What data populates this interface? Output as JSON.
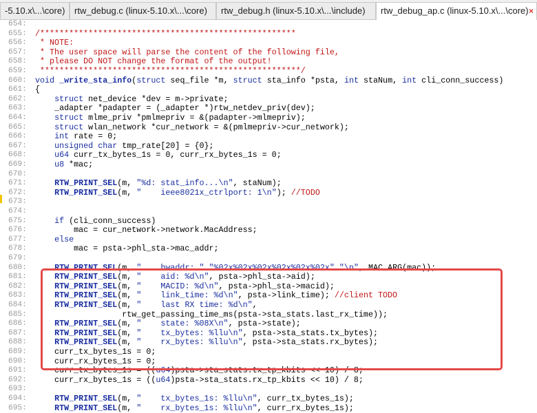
{
  "tabs": [
    {
      "label": "-5.10.x\\...\\core)",
      "active": false
    },
    {
      "label": "rtw_debug.c (linux-5.10.x\\...\\core)",
      "active": false
    },
    {
      "label": "rtw_debug.h (linux-5.10.x\\...\\include)",
      "active": false
    },
    {
      "label": "rtw_debug_ap.c (linux-5.10.x\\...\\core)",
      "active": true
    }
  ],
  "close_glyph": "×",
  "lines": [
    {
      "n": "654:",
      "t": ""
    },
    {
      "n": "655:",
      "t": "/*****************************************************"
    },
    {
      "n": "656:",
      "t": " * NOTE:"
    },
    {
      "n": "657:",
      "t": " * The user space will parse the content of the following file,"
    },
    {
      "n": "658:",
      "t": " * please DO NOT change the format of the output!"
    },
    {
      "n": "659:",
      "t": " ******************************************************/"
    },
    {
      "n": "660:",
      "t": "void _write_sta_info(struct seq_file *m, struct sta_info *psta, int staNum, int cli_conn_success)"
    },
    {
      "n": "661:",
      "t": "{"
    },
    {
      "n": "662:",
      "t": "    struct net_device *dev = m->private;"
    },
    {
      "n": "663:",
      "t": "    _adapter *padapter = (_adapter *)rtw_netdev_priv(dev);"
    },
    {
      "n": "664:",
      "t": "    struct mlme_priv *pmlmepriv = &(padapter->mlmepriv);"
    },
    {
      "n": "665:",
      "t": "    struct wlan_network *cur_network = &(pmlmepriv->cur_network);"
    },
    {
      "n": "666:",
      "t": "    int rate = 0;"
    },
    {
      "n": "667:",
      "t": "    unsigned char tmp_rate[20] = {0};"
    },
    {
      "n": "668:",
      "t": "    u64 curr_tx_bytes_1s = 0, curr_rx_bytes_1s = 0;"
    },
    {
      "n": "669:",
      "t": "    u8 *mac;"
    },
    {
      "n": "670:",
      "t": ""
    },
    {
      "n": "671:",
      "t": "    RTW_PRINT_SEL(m, \"%d: stat_info...\\n\", staNum);"
    },
    {
      "n": "672:",
      "t": "    RTW_PRINT_SEL(m, \"    ieee8021x_ctrlport: 1\\n\"); //TODO"
    },
    {
      "n": "673:",
      "t": ""
    },
    {
      "n": "674:",
      "t": ""
    },
    {
      "n": "675:",
      "t": "    if (cli_conn_success)"
    },
    {
      "n": "676:",
      "t": "        mac = cur_network->network.MacAddress;"
    },
    {
      "n": "677:",
      "t": "    else"
    },
    {
      "n": "678:",
      "t": "        mac = psta->phl_sta->mac_addr;"
    },
    {
      "n": "679:",
      "t": ""
    },
    {
      "n": "680:",
      "t": "    RTW_PRINT_SEL(m, \"    hwaddr: \" \"%02x%02x%02x%02x%02x%02x\" \"\\n\", MAC_ARG(mac));"
    },
    {
      "n": "681:",
      "t": "    RTW_PRINT_SEL(m, \"    aid: %d\\n\", psta->phl_sta->aid);"
    },
    {
      "n": "682:",
      "t": "    RTW_PRINT_SEL(m, \"    MACID: %d\\n\", psta->phl_sta->macid);"
    },
    {
      "n": "683:",
      "t": "    RTW_PRINT_SEL(m, \"    link_time: %d\\n\", psta->link_time); //client TODO"
    },
    {
      "n": "684:",
      "t": "    RTW_PRINT_SEL(m, \"    last RX time: %d\\n\","
    },
    {
      "n": "685:",
      "t": "                  rtw_get_passing_time_ms(psta->sta_stats.last_rx_time));"
    },
    {
      "n": "686:",
      "t": "    RTW_PRINT_SEL(m, \"    state: %08X\\n\", psta->state);"
    },
    {
      "n": "687:",
      "t": "    RTW_PRINT_SEL(m, \"    tx_bytes: %llu\\n\", psta->sta_stats.tx_bytes);"
    },
    {
      "n": "688:",
      "t": "    RTW_PRINT_SEL(m, \"    rx_bytes: %llu\\n\", psta->sta_stats.rx_bytes);"
    },
    {
      "n": "689:",
      "t": "    curr_tx_bytes_1s = 0;"
    },
    {
      "n": "690:",
      "t": "    curr_rx_bytes_1s = 0;"
    },
    {
      "n": "691:",
      "t": "    curr_tx_bytes_1s = ((u64)psta->sta_stats.tx_tp_kbits << 10) / 8;"
    },
    {
      "n": "692:",
      "t": "    curr_rx_bytes_1s = ((u64)psta->sta_stats.rx_tp_kbits << 10) / 8;"
    },
    {
      "n": "693:",
      "t": ""
    },
    {
      "n": "694:",
      "t": "    RTW_PRINT_SEL(m, \"    tx_bytes_1s: %llu\\n\", curr_tx_bytes_1s);"
    },
    {
      "n": "695:",
      "t": "    RTW_PRINT_SEL(m, \"    rx_bytes_1s: %llu\\n\", curr_rx_bytes_1s);"
    }
  ],
  "colors": {
    "comment": "#c01515",
    "keyword": "#1a2ea0",
    "highlight_box": "#e44848",
    "change_marker": "#f3c500"
  }
}
